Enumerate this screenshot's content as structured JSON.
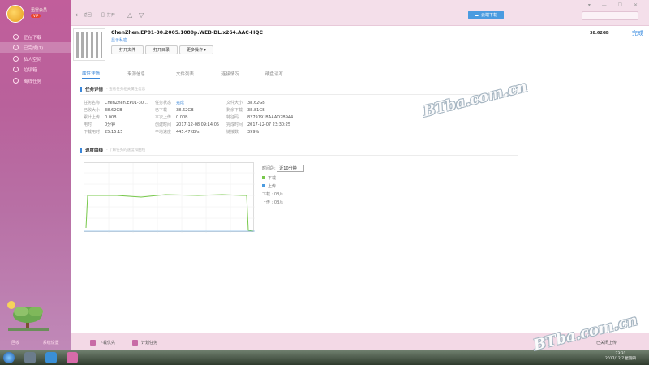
{
  "sidebar": {
    "username": "迅雷会员",
    "vip_label": "VIP",
    "items": [
      {
        "label": "正在下载",
        "active": false
      },
      {
        "label": "已完成(1)",
        "active": true
      },
      {
        "label": "私人空间",
        "active": false
      },
      {
        "label": "垃圾箱",
        "active": false
      },
      {
        "label": "离线任务",
        "active": false
      }
    ],
    "footer": [
      "回收",
      "系统设置"
    ]
  },
  "toolbar": {
    "back_label": "返回",
    "open_label": "打开",
    "cloud_button": "云端下载",
    "window_controls": "▾ — ☐ ✕"
  },
  "file": {
    "name": "ChenZhen.EP01-30.2005.1080p.WEB-DL.x264.AAC-HQC",
    "subtitle": "显示私密",
    "size": "38.62GB",
    "status": "完成",
    "actions": [
      "打开文件",
      "打开目录",
      "更多操作 ▾"
    ]
  },
  "tabs": [
    "属性详情",
    "来源信息",
    "文件列表",
    "连接情况",
    "硬盘读写"
  ],
  "task_details": {
    "title": "任务详情",
    "subtitle": "- 查看任务相关属性信息",
    "rows": [
      [
        [
          "任务名称",
          "ChenZhen.EP01-30..."
        ],
        [
          "任务状态",
          "完成"
        ],
        [
          "文件大小",
          "38.62GB"
        ]
      ],
      [
        [
          "已收大小",
          "38.62GB"
        ],
        [
          "已下载",
          "38.62GB"
        ],
        [
          "剩余下载",
          "38.81GB"
        ]
      ],
      [
        [
          "累计上传",
          "0.00B"
        ],
        [
          "本次上传",
          "0.00B"
        ],
        [
          "特征码",
          "8279191BAAAD2B944..."
        ]
      ],
      [
        [
          "用时",
          "0分钟"
        ],
        [
          "创建时间",
          "2017-12-08 09:14:05"
        ],
        [
          "完成时间",
          "2017-12-07 23:30:25"
        ]
      ],
      [
        [
          "下载用时",
          "25:15:15"
        ],
        [
          "平均速度",
          "445.47KB/s"
        ],
        [
          "链接数",
          "399%"
        ]
      ]
    ]
  },
  "speed_section": {
    "title": "速度曲线",
    "subtitle": "- 了解任务的速度和曲线",
    "duration_label": "时间段:",
    "duration_value": "近10分钟",
    "legend_download": "下载",
    "legend_upload": "上传",
    "download_speed": "下载 : 0B/s",
    "upload_speed": "上传 : 0B/s",
    "colors": {
      "download": "#77c84a",
      "upload": "#4a9be0"
    }
  },
  "statusbar": {
    "tabs": [
      "下载优先",
      "计划任务"
    ],
    "right_label": "已关闭上传"
  },
  "taskbar": {
    "time": "23:31",
    "date": "2017/12/7 星期四"
  },
  "watermarks": [
    "BTba.com.cn",
    "BTba.com.cn"
  ]
}
